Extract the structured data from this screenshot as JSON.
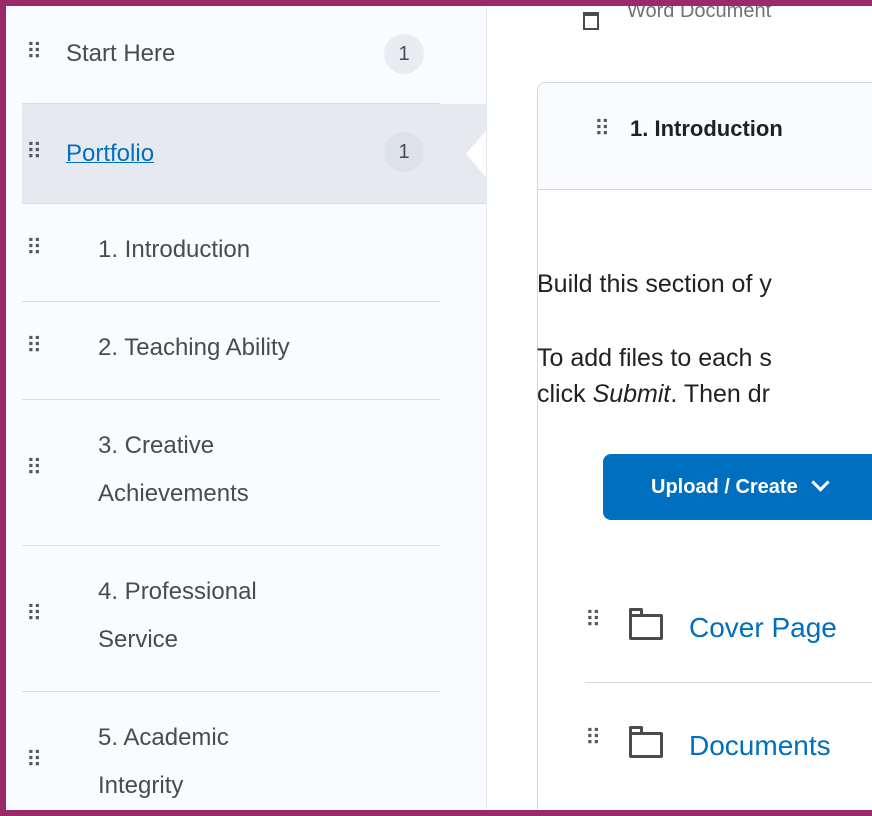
{
  "nav": {
    "items": [
      {
        "label": "Start Here",
        "badge": "1"
      },
      {
        "label": "Portfolio",
        "badge": "1"
      },
      {
        "label": "1. Introduction"
      },
      {
        "label": "2. Teaching Ability"
      },
      {
        "label_line1": "3. Creative",
        "label_line2": "Achievements"
      },
      {
        "label_line1": "4. Professional",
        "label_line2": "Service"
      },
      {
        "label_line1": "5. Academic",
        "label_line2": "Integrity"
      }
    ]
  },
  "main": {
    "doc_link": "Word Document",
    "card_title": "1. Introduction",
    "para1": "Build this section of y",
    "para2_line1": "To add files to each s",
    "para2_line2_a": "click ",
    "para2_line2_em": "Submit",
    "para2_line2_b": ".  Then dr",
    "upload_label": "Upload / Create",
    "folders": [
      {
        "label": "Cover Page"
      },
      {
        "label": "Documents"
      }
    ]
  },
  "colors": {
    "frame": "#9b2a6a",
    "link": "#006fbf",
    "button": "#006fbf"
  }
}
